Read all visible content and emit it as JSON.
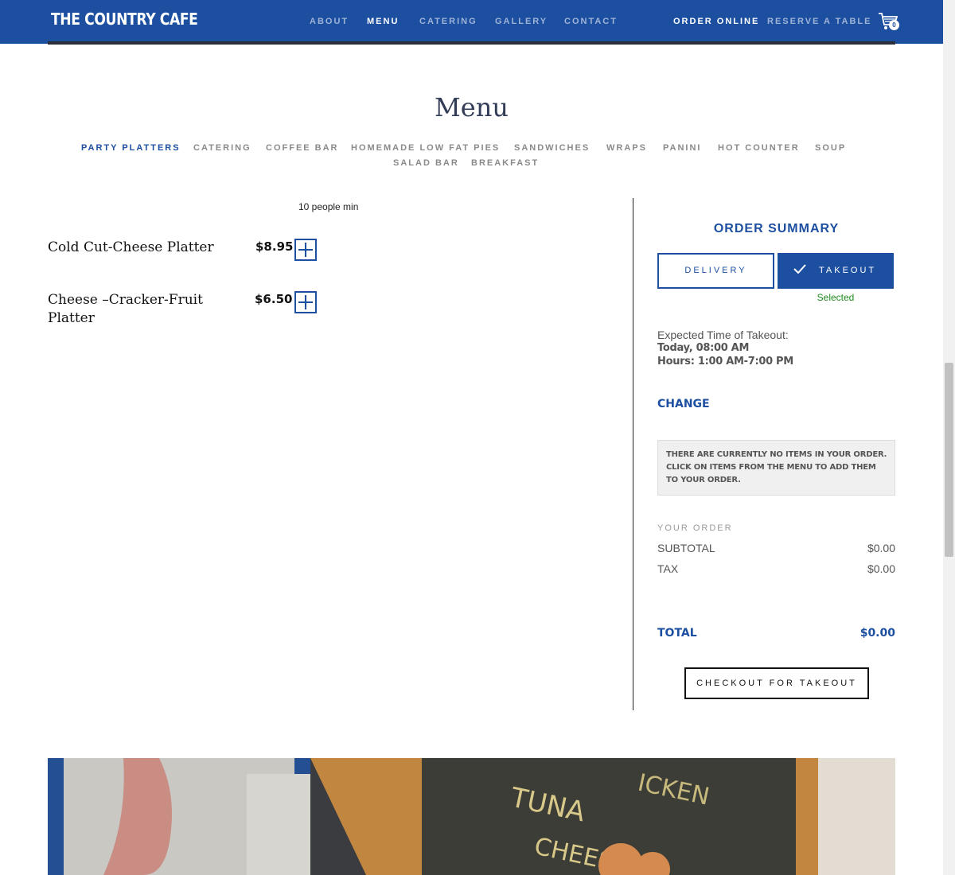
{
  "header": {
    "logo": "THE COUNTRY CAFE",
    "nav": [
      "ABOUT",
      "MENU",
      "CATERING",
      "GALLERY",
      "CONTACT"
    ],
    "active_nav": "MENU",
    "order_online": "ORDER ONLINE",
    "reserve": "RESERVE A TABLE",
    "cart_count": "0"
  },
  "menu": {
    "title": "Menu",
    "categories": [
      "PARTY PLATTERS",
      "CATERING",
      "COFFEE BAR",
      "HOMEMADE LOW FAT PIES",
      "SANDWICHES",
      "WRAPS",
      "PANINI",
      "HOT COUNTER",
      "SOUP",
      "SALAD BAR",
      "BREAKFAST"
    ],
    "active_category": "PARTY PLATTERS",
    "note": "10 people min",
    "items": [
      {
        "name": "Cold Cut-Cheese Platter",
        "price": "$8.95"
      },
      {
        "name": "Cheese –Cracker-Fruit Platter",
        "price": "$6.50"
      }
    ]
  },
  "summary": {
    "title": "ORDER SUMMARY",
    "delivery_label": "DELIVERY",
    "takeout_label": "TAKEOUT",
    "selected_text": "Selected",
    "expected_label": "Expected Time of Takeout:",
    "expected_time": "Today, 08:00 AM",
    "hours": "Hours: 1:00 AM-7:00 PM",
    "change_label": "CHANGE",
    "empty_message": "THERE ARE CURRENTLY NO ITEMS IN YOUR ORDER. CLICK ON ITEMS FROM THE MENU TO ADD THEM TO YOUR ORDER.",
    "your_order_label": "YOUR ORDER",
    "subtotal_label": "SUBTOTAL",
    "subtotal_value": "$0.00",
    "tax_label": "TAX",
    "tax_value": "$0.00",
    "total_label": "TOTAL",
    "total_value": "$0.00",
    "checkout_label": "CHECKOUT FOR TAKEOUT"
  },
  "colors": {
    "brand": "#1d4fa1",
    "success": "#1e8c1e"
  }
}
